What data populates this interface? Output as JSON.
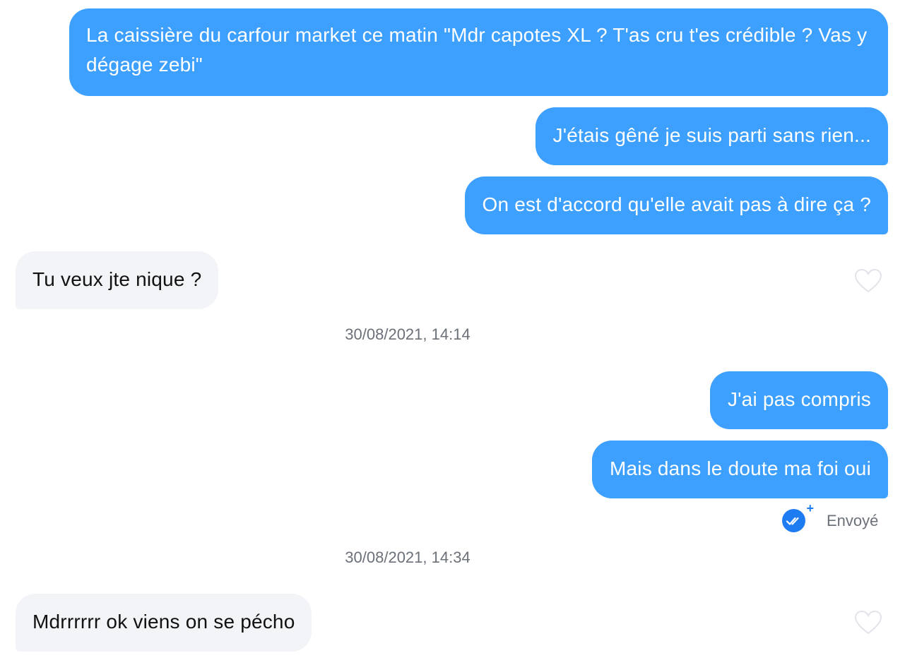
{
  "messages": [
    {
      "side": "sent",
      "text": "La caissière du carfour market ce matin \"Mdr capotes XL ? T'as cru t'es crédible ? Vas y dégage zebi\""
    },
    {
      "side": "sent",
      "text": "J'étais gêné je suis parti sans rien..."
    },
    {
      "side": "sent",
      "text": "On est d'accord qu'elle avait pas à dire ça ?"
    },
    {
      "side": "received",
      "text": "Tu veux jte nique ?"
    },
    {
      "side": "sent",
      "text": "J'ai pas compris"
    },
    {
      "side": "sent",
      "text": "Mais dans le doute ma foi oui"
    },
    {
      "side": "received",
      "text": "Mdrrrrrr ok viens on se pécho"
    }
  ],
  "timestamps": [
    "30/08/2021, 14:14",
    "30/08/2021, 14:34"
  ],
  "delivery_status": {
    "label": "Envoyé",
    "icon": "double-check-icon",
    "badge_color": "#1e7cf2"
  },
  "colors": {
    "sent_bubble": "#3d9ffe",
    "received_bubble": "#f3f4f8",
    "muted_text": "#6b7079"
  }
}
